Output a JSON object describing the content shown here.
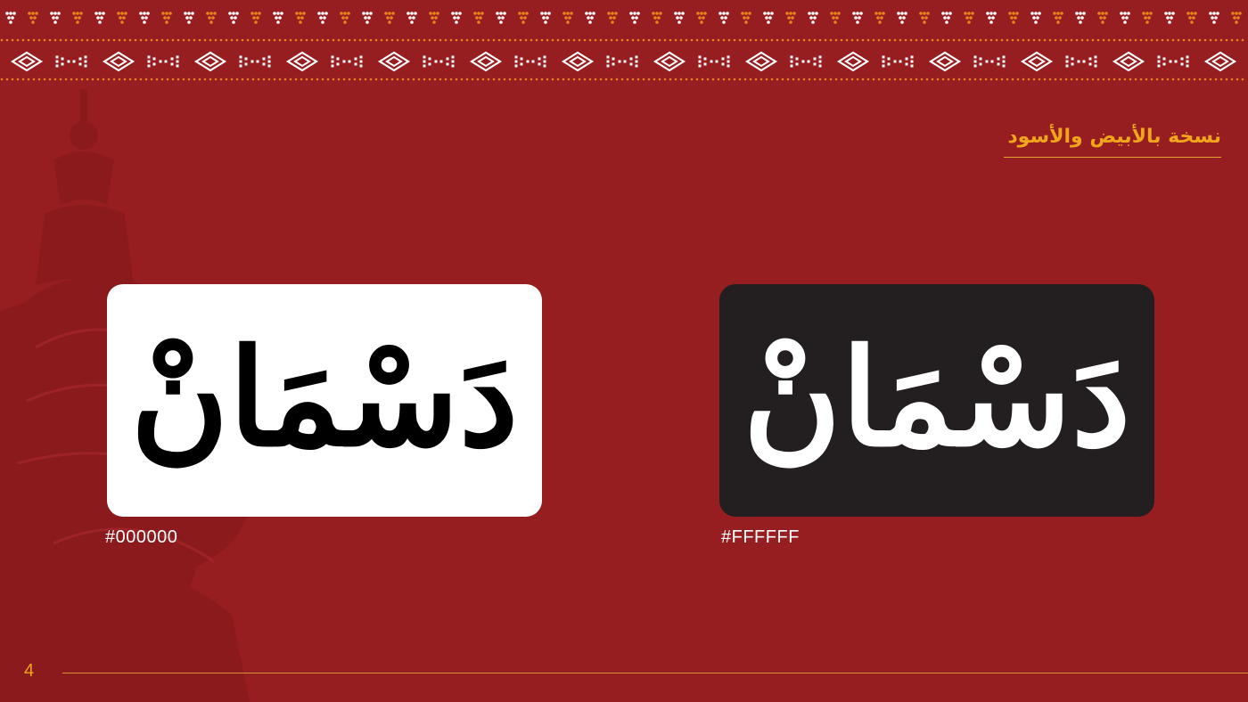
{
  "section_title": "نسخة بالأبيض والأسود",
  "cards": [
    {
      "logo_text": "دَسْمَانْ",
      "hex": "#000000",
      "logo_color": "#000000",
      "card_color": "#ffffff"
    },
    {
      "logo_text": "دَسْمَانْ",
      "hex": "#FFFFFF",
      "logo_color": "#ffffff",
      "card_color": "#231f20"
    }
  ],
  "page_number": "4",
  "colors": {
    "background": "#961d20",
    "accent": "#f0a51c",
    "pattern_white": "#ffffff",
    "pattern_orange": "#e8841c"
  }
}
